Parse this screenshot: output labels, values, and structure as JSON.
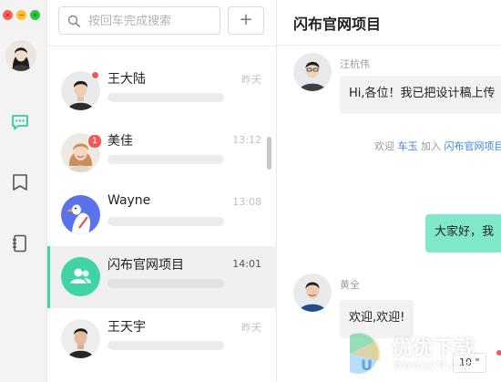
{
  "window": {
    "controls": {
      "close_color": "#fe5f57",
      "minimize_color": "#febc2e",
      "maximize_color": "#28c840"
    }
  },
  "rail": {
    "accent_color": "#37c9a0",
    "icons": [
      "chat-icon",
      "notebook-icon",
      "contacts-book-icon"
    ]
  },
  "search": {
    "placeholder": "按回车完成搜索"
  },
  "add_button": {
    "label": "+"
  },
  "conversations": [
    {
      "name": "王大陆",
      "time": "昨天",
      "unread_dot": true
    },
    {
      "name": "美佳",
      "time": "13:12",
      "unread_count": "1"
    },
    {
      "name": "Wayne",
      "time": "13:08"
    },
    {
      "name": "闪布官网项目",
      "time": "14:01",
      "active": true
    },
    {
      "name": "王天宇",
      "time": "昨天"
    }
  ],
  "chat": {
    "title": "闪布官网项目",
    "messages": [
      {
        "sender": "汪杭伟",
        "text": "Hi,各位！我已把设计稿上传"
      },
      {
        "system": {
          "prefix": "欢迎 ",
          "user": "车玉",
          "middle": " 加入 ",
          "group": "闪布官网项目"
        }
      },
      {
        "mine": true,
        "text": "大家好，我"
      },
      {
        "sender": "黄全",
        "text": "欢迎,欢迎!"
      }
    ],
    "mini_badge": "10 \""
  },
  "colors": {
    "active_bar": "#41d3a3",
    "my_bubble": "#7ee8c9",
    "badge": "#f05b57",
    "link_blue": "#3b86d6"
  },
  "watermark": {
    "text": "优优下载",
    "url": "www.yyxt.com"
  }
}
